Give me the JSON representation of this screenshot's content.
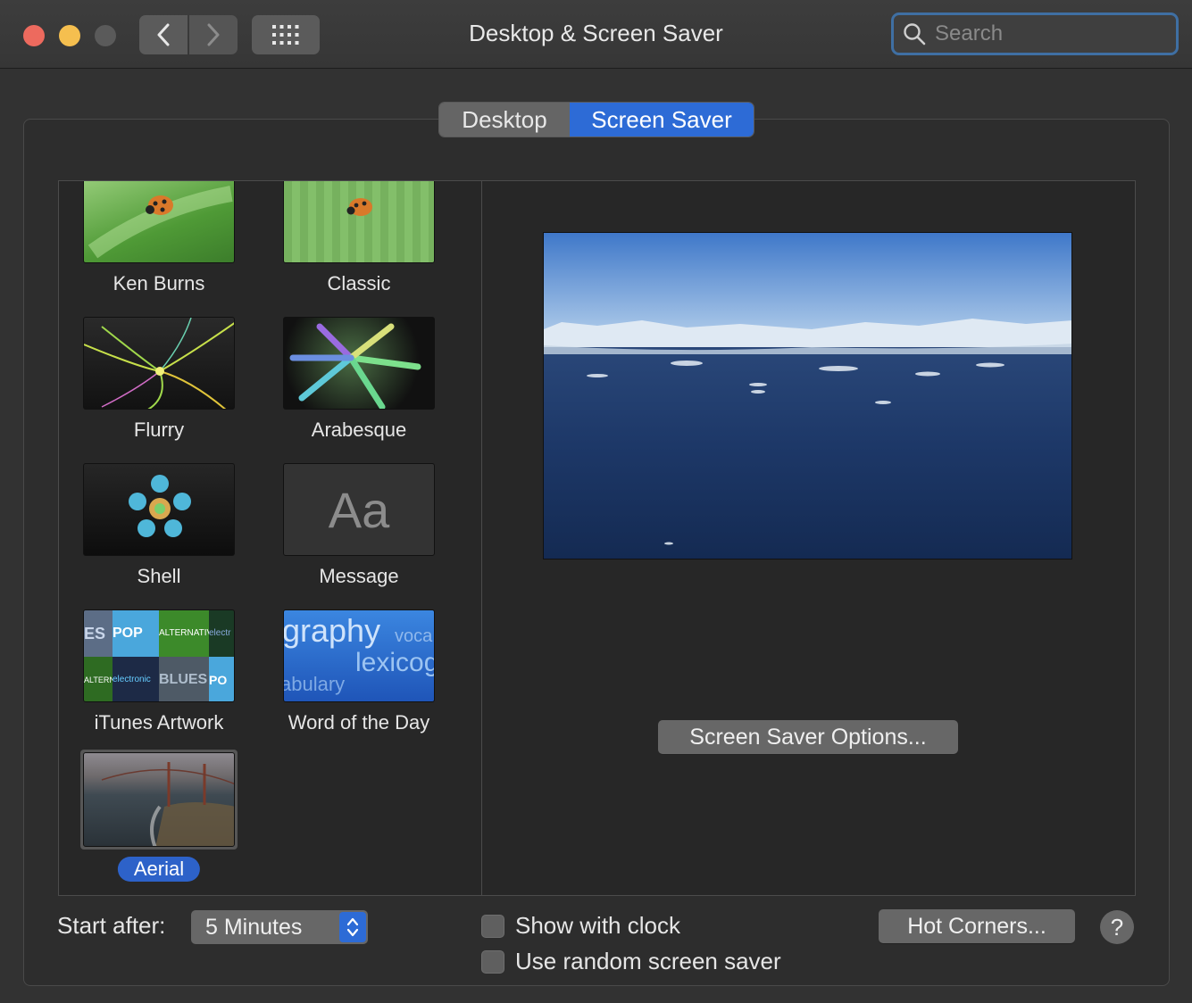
{
  "window": {
    "title": "Desktop & Screen Saver"
  },
  "search": {
    "placeholder": "Search"
  },
  "tabs": [
    {
      "label": "Desktop",
      "selected": false
    },
    {
      "label": "Screen Saver",
      "selected": true
    }
  ],
  "savers": [
    {
      "label": "Ken Burns",
      "icon": "ladybug-leaf-thumbnail"
    },
    {
      "label": "Classic",
      "icon": "ladybug-forest-thumbnail"
    },
    {
      "label": "Flurry",
      "icon": "flurry-thumbnail"
    },
    {
      "label": "Arabesque",
      "icon": "arabesque-thumbnail"
    },
    {
      "label": "Shell",
      "icon": "shell-thumbnail"
    },
    {
      "label": "Message",
      "icon": "message-thumbnail",
      "glyph": "Aa"
    },
    {
      "label": "iTunes Artwork",
      "icon": "itunes-artwork-thumbnail"
    },
    {
      "label": "Word of the Day",
      "icon": "word-of-the-day-thumbnail"
    },
    {
      "label": "Aerial",
      "icon": "aerial-thumbnail",
      "selected": true
    }
  ],
  "word_of_day_thumb": {
    "line1": "graphy",
    "line1b": "voca",
    "line2": "lexicog",
    "line3": "abulary"
  },
  "itunes_thumb": {
    "t1": "ES",
    "t2": "POP",
    "t3": "ALTERNATIVE",
    "t4": "electr",
    "t5": "ALTERNATIVE",
    "t6": "electronic",
    "t7": "BLUES",
    "t8": "PO"
  },
  "options_button": "Screen Saver Options...",
  "start_after": {
    "label": "Start after:",
    "value": "5 Minutes"
  },
  "checkboxes": [
    {
      "label": "Show with clock",
      "checked": false
    },
    {
      "label": "Use random screen saver",
      "checked": false
    }
  ],
  "hot_corners_button": "Hot Corners...",
  "help": "?",
  "colors": {
    "accent": "#2d6bd6",
    "selection": "#2d62c9",
    "background": "#323232"
  }
}
